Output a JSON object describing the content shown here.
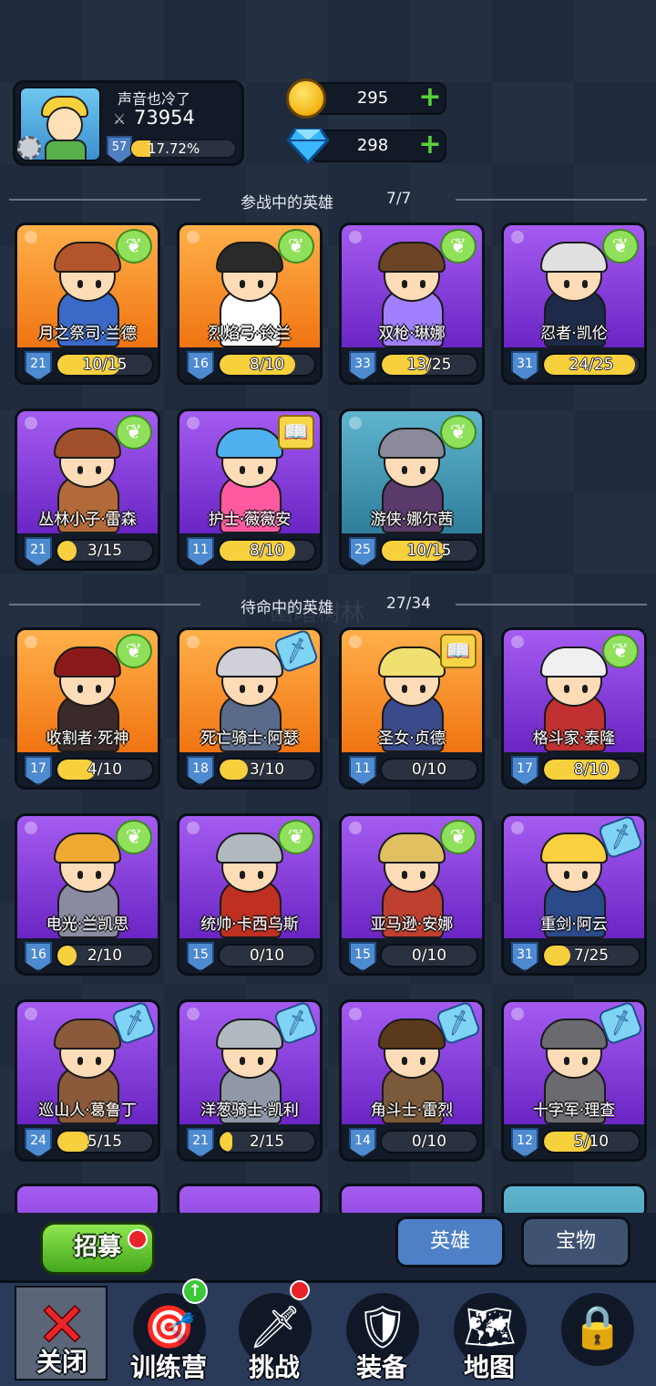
{
  "profile": {
    "name": "声音也冷了",
    "power": "73954",
    "level": "57",
    "xp_percent": "17.72%",
    "xp_fraction": 0.18
  },
  "currency": {
    "gold": "295",
    "gems": "298"
  },
  "active_section": {
    "title": "参战中的英雄",
    "count": "7/7"
  },
  "reserve_section": {
    "title": "待命中的英雄",
    "count": "27/34"
  },
  "watermark": "幽暗树林",
  "active_heroes": [
    {
      "name": "月之祭司·兰德",
      "level": "21",
      "progress": "10/15",
      "frac": 0.667,
      "color": "orange",
      "badge": "leaf",
      "hair": "#b3552a",
      "body": "#3a69c8"
    },
    {
      "name": "烈焰弓·铃兰",
      "level": "16",
      "progress": "8/10",
      "frac": 0.8,
      "color": "orange",
      "badge": "leaf",
      "hair": "#2a2a2a",
      "body": "#ffffff"
    },
    {
      "name": "双枪·琳娜",
      "level": "33",
      "progress": "13/25",
      "frac": 0.52,
      "color": "purple",
      "badge": "leaf",
      "hair": "#6a4424",
      "body": "#a080ff"
    },
    {
      "name": "忍者·凯伦",
      "level": "31",
      "progress": "24/25",
      "frac": 0.96,
      "color": "purple",
      "badge": "leaf",
      "hair": "#e0e0e0",
      "body": "#1d2a4a"
    },
    {
      "name": "丛林小子·雷森",
      "level": "21",
      "progress": "3/15",
      "frac": 0.2,
      "color": "purple",
      "badge": "leaf",
      "hair": "#a0502a",
      "body": "#b36a3a"
    },
    {
      "name": "护士·薇薇安",
      "level": "11",
      "progress": "8/10",
      "frac": 0.8,
      "color": "purple",
      "badge": "book",
      "hair": "#4fb0f0",
      "body": "#ff5aa0"
    },
    {
      "name": "游侠·娜尔茜",
      "level": "25",
      "progress": "10/15",
      "frac": 0.667,
      "color": "blue",
      "badge": "leaf",
      "hair": "#8a8a9a",
      "body": "#5a3a6a"
    }
  ],
  "reserve_heroes": [
    {
      "name": "收割者·死神",
      "level": "17",
      "progress": "4/10",
      "frac": 0.4,
      "color": "orange",
      "badge": "leaf",
      "hair": "#8a1a1a",
      "body": "#3a2a2a"
    },
    {
      "name": "死亡骑士·阿瑟",
      "level": "18",
      "progress": "3/10",
      "frac": 0.3,
      "color": "orange",
      "badge": "sword",
      "hair": "#d0d0d8",
      "body": "#5a6a8a"
    },
    {
      "name": "圣女·贞德",
      "level": "11",
      "progress": "0/10",
      "frac": 0.0,
      "color": "orange",
      "badge": "book",
      "hair": "#f0e070",
      "body": "#3a4a8a"
    },
    {
      "name": "格斗家·泰隆",
      "level": "17",
      "progress": "8/10",
      "frac": 0.8,
      "color": "purple",
      "badge": "leaf",
      "hair": "#f0f0f0",
      "body": "#c03030"
    },
    {
      "name": "电光·兰凯思",
      "level": "16",
      "progress": "2/10",
      "frac": 0.2,
      "color": "purple",
      "badge": "leaf",
      "hair": "#f0a830",
      "body": "#8a8aa0"
    },
    {
      "name": "统帅·卡西乌斯",
      "level": "15",
      "progress": "0/10",
      "frac": 0.0,
      "color": "purple",
      "badge": "leaf",
      "hair": "#b0b8c0",
      "body": "#c03020"
    },
    {
      "name": "亚马逊·安娜",
      "level": "15",
      "progress": "0/10",
      "frac": 0.0,
      "color": "purple",
      "badge": "leaf",
      "hair": "#e0c060",
      "body": "#c04030"
    },
    {
      "name": "重剑·阿云",
      "level": "31",
      "progress": "7/25",
      "frac": 0.28,
      "color": "purple",
      "badge": "sword",
      "hair": "#f8d040",
      "body": "#2a4a8a"
    },
    {
      "name": "巡山人·葛鲁丁",
      "level": "24",
      "progress": "5/15",
      "frac": 0.333,
      "color": "purple",
      "badge": "sword",
      "hair": "#8a5a3a",
      "body": "#8a5a3a"
    },
    {
      "name": "洋葱骑士·凯利",
      "level": "21",
      "progress": "2/15",
      "frac": 0.133,
      "color": "purple",
      "badge": "sword",
      "hair": "#b0b8c0",
      "body": "#9098a8"
    },
    {
      "name": "角斗士·雷烈",
      "level": "14",
      "progress": "0/10",
      "frac": 0.0,
      "color": "purple",
      "badge": "sword",
      "hair": "#5a3a1a",
      "body": "#7a5a3a"
    },
    {
      "name": "十字军·理查",
      "level": "12",
      "progress": "5/10",
      "frac": 0.5,
      "color": "purple",
      "badge": "sword",
      "hair": "#6a6a70",
      "body": "#6a6a70"
    }
  ],
  "actions": {
    "recruit": "招募",
    "tab_heroes": "英雄",
    "tab_treasure": "宝物"
  },
  "nav": {
    "close": "关闭",
    "camp": "训练营",
    "challenge": "挑战",
    "equip": "装备",
    "map": "地图"
  }
}
